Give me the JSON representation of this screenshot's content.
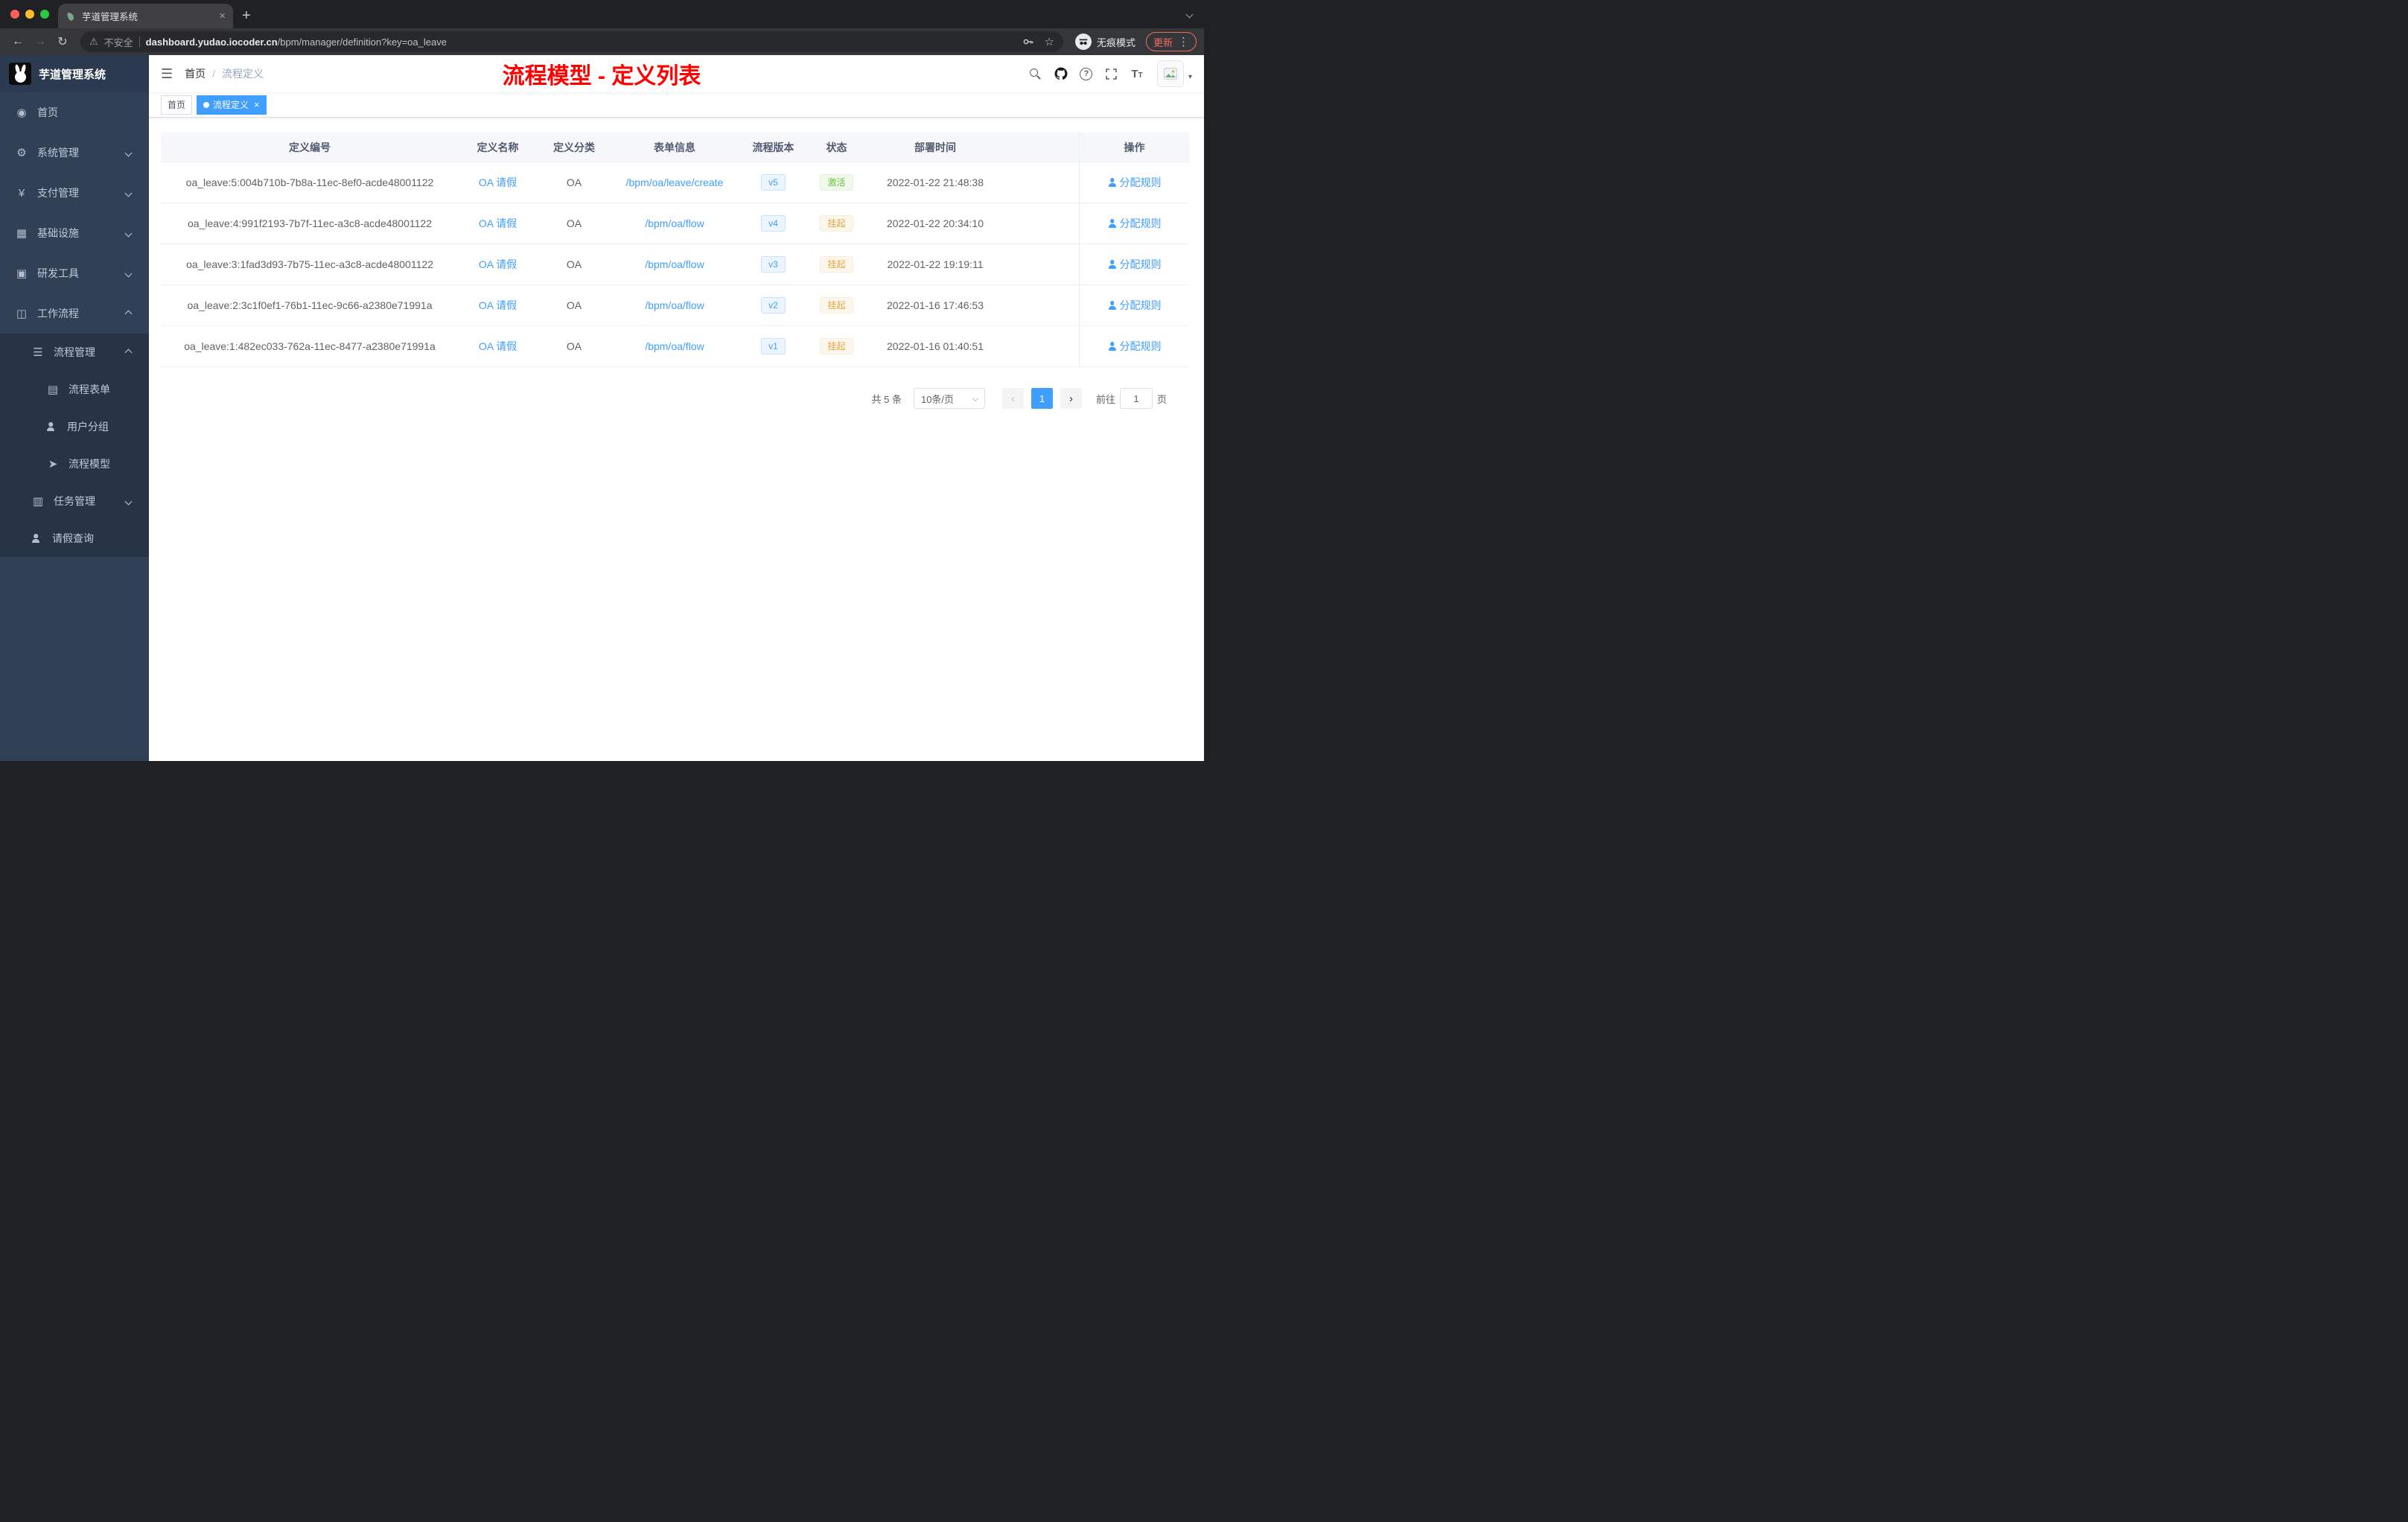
{
  "colors": {
    "accent": "#409eff",
    "success": "#67c23a",
    "warning": "#e6a23c",
    "title_red": "#ff0000"
  },
  "browser": {
    "tab_title": "芋道管理系统",
    "security_label": "不安全",
    "url_host": "dashboard.yudao.iocoder.cn",
    "url_path": "/bpm/manager/definition?key=oa_leave",
    "incognito_label": "无痕模式",
    "update_label": "更新"
  },
  "sidebar": {
    "logo_title": "芋道管理系统",
    "items": [
      {
        "label": "首页",
        "icon": "home",
        "level": 1
      },
      {
        "label": "系统管理",
        "icon": "gear",
        "level": 1,
        "chevron": "down"
      },
      {
        "label": "支付管理",
        "icon": "yen",
        "level": 1,
        "chevron": "down"
      },
      {
        "label": "基础设施",
        "icon": "infra",
        "level": 1,
        "chevron": "down"
      },
      {
        "label": "研发工具",
        "icon": "tools",
        "level": 1,
        "chevron": "down"
      },
      {
        "label": "工作流程",
        "icon": "workflow",
        "level": 1,
        "chevron": "up"
      },
      {
        "label": "流程管理",
        "icon": "process",
        "level": 2,
        "chevron": "up",
        "sub": true
      },
      {
        "label": "流程表单",
        "icon": "form",
        "level": 3,
        "sub": true
      },
      {
        "label": "用户分组",
        "icon": "person",
        "level": 3,
        "sub": true
      },
      {
        "label": "流程模型",
        "icon": "model",
        "level": 3,
        "sub": true
      },
      {
        "label": "任务管理",
        "icon": "task",
        "level": 2,
        "chevron": "down",
        "sub": true
      },
      {
        "label": "请假查询",
        "icon": "person",
        "level": 2,
        "sub": true
      }
    ]
  },
  "navbar": {
    "breadcrumb": {
      "home": "首页",
      "separator": "/",
      "current": "流程定义"
    },
    "page_title": "流程模型 - 定义列表"
  },
  "tags": [
    {
      "label": "首页",
      "active": false,
      "closable": false
    },
    {
      "label": "流程定义",
      "active": true,
      "closable": true
    }
  ],
  "table": {
    "columns": {
      "id": "定义编号",
      "name": "定义名称",
      "category": "定义分类",
      "form": "表单信息",
      "version": "流程版本",
      "status": "状态",
      "deploy_time": "部署时间",
      "action": "操作"
    },
    "rows": [
      {
        "id": "oa_leave:5:004b710b-7b8a-11ec-8ef0-acde48001122",
        "name": "OA 请假",
        "category": "OA",
        "form": "/bpm/oa/leave/create",
        "version": "v5",
        "status": "激活",
        "status_type": "success",
        "deploy_time": "2022-01-22 21:48:38",
        "action": "分配规则"
      },
      {
        "id": "oa_leave:4:991f2193-7b7f-11ec-a3c8-acde48001122",
        "name": "OA 请假",
        "category": "OA",
        "form": "/bpm/oa/flow",
        "version": "v4",
        "status": "挂起",
        "status_type": "warning",
        "deploy_time": "2022-01-22 20:34:10",
        "action": "分配规则"
      },
      {
        "id": "oa_leave:3:1fad3d93-7b75-11ec-a3c8-acde48001122",
        "name": "OA 请假",
        "category": "OA",
        "form": "/bpm/oa/flow",
        "version": "v3",
        "status": "挂起",
        "status_type": "warning",
        "deploy_time": "2022-01-22 19:19:11",
        "action": "分配规则"
      },
      {
        "id": "oa_leave:2:3c1f0ef1-76b1-11ec-9c66-a2380e71991a",
        "name": "OA 请假",
        "category": "OA",
        "form": "/bpm/oa/flow",
        "version": "v2",
        "status": "挂起",
        "status_type": "warning",
        "deploy_time": "2022-01-16 17:46:53",
        "action": "分配规则"
      },
      {
        "id": "oa_leave:1:482ec033-762a-11ec-8477-a2380e71991a",
        "name": "OA 请假",
        "category": "OA",
        "form": "/bpm/oa/flow",
        "version": "v1",
        "status": "挂起",
        "status_type": "warning",
        "deploy_time": "2022-01-16 01:40:51",
        "action": "分配规则"
      }
    ]
  },
  "pagination": {
    "total": "共 5 条",
    "page_size": "10条/页",
    "current_page": "1",
    "goto_label": "前往",
    "goto_value": "1",
    "goto_unit": "页"
  },
  "icons": {
    "home": "◉",
    "gear": "⚙",
    "yen": "¥",
    "infra": "▦",
    "tools": "▣",
    "workflow": "◫",
    "process": "☰",
    "form": "▤",
    "model": "➤",
    "task": "▥",
    "hamburger": "☰",
    "back": "←",
    "forward": "→",
    "reload": "↻",
    "warning": "⚠",
    "star": "☆",
    "more": "⋮",
    "plus": "+",
    "close": "×"
  }
}
